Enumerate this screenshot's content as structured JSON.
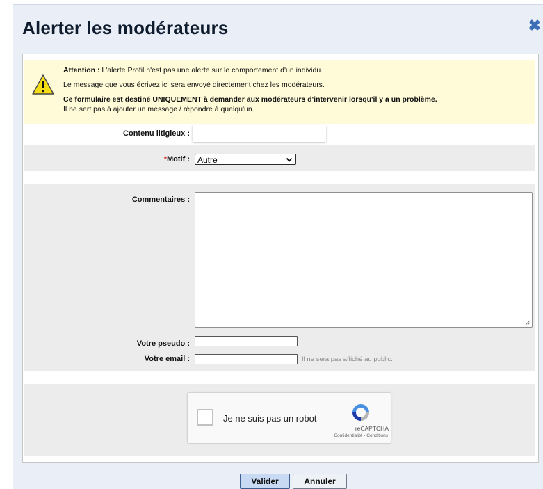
{
  "dialog": {
    "title": "Alerter les modérateurs",
    "close_icon": "close-icon"
  },
  "warning": {
    "line1_bold": "Attention :",
    "line1_rest": " L'alerte Profil n'est pas une alerte sur le comportement d'un individu.",
    "line2": "Le message que vous écrivez ici sera envoyé directement chez les modérateurs.",
    "line3": "Ce formulaire est destiné UNIQUEMENT à demander aux modérateurs d'intervenir lorsqu'il y a un problème.",
    "line4": "Il ne sert pas à ajouter un message / répondre à quelqu'un.",
    "icon": "warning-icon"
  },
  "form": {
    "contenu_label": "Contenu litigieux :",
    "motif_required": "*",
    "motif_label": "Motif :",
    "motif_value": "Autre",
    "commentaires_label": "Commentaires :",
    "commentaires_value": "",
    "pseudo_label": "Votre pseudo :",
    "pseudo_value": "",
    "email_label": "Votre email :",
    "email_value": "",
    "email_hint": "Il ne sera pas affiché au public."
  },
  "captcha": {
    "label": "Je ne suis pas un robot",
    "brand": "reCAPTCHA",
    "links": "Confidentialité - Conditions"
  },
  "buttons": {
    "submit": "Valider",
    "cancel": "Annuler"
  },
  "colors": {
    "modal_bg": "#e9eef7",
    "warning_bg": "#fffbd8",
    "accent": "#3c6fb6",
    "required": "#d23a3a"
  }
}
